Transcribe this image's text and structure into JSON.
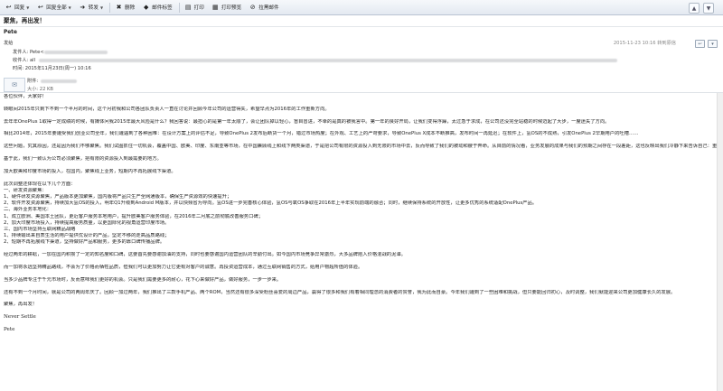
{
  "toolbar": {
    "items": [
      {
        "label": "回复",
        "icon": "reply-icon",
        "glyph": "↩",
        "dropdown": true
      },
      {
        "label": "回复全部",
        "icon": "reply-all-icon",
        "glyph": "↩",
        "dropdown": true
      },
      {
        "label": "转发",
        "icon": "forward-icon",
        "glyph": "➜",
        "dropdown": true
      },
      {
        "label": "删除",
        "icon": "delete-icon",
        "glyph": "✖",
        "dropdown": false
      },
      {
        "label": "邮件标签",
        "icon": "tag-icon",
        "glyph": "◆",
        "dropdown": false
      },
      {
        "label": "打印",
        "icon": "print-icon",
        "glyph": "▤",
        "dropdown": false
      },
      {
        "label": "打印预览",
        "icon": "print-preview-icon",
        "glyph": "▦",
        "dropdown": false
      },
      {
        "label": "拉黑邮件",
        "icon": "block-icon",
        "glyph": "⊘",
        "dropdown": false
      }
    ],
    "nav_up": "▲",
    "nav_down": "▼"
  },
  "message": {
    "subject": "聚焦，再出发！",
    "sender": "Pete",
    "from_label": "发给",
    "sender_line": "发件人: Pete<",
    "recipients_label": "收件人: all",
    "time_line": "时间: 2015年11月23日(周一) 10:16",
    "datetime": "2015-11-23 10:16",
    "datetime_suffix": "转到原信",
    "attachment_label": "附件:",
    "size_line": "大小: 22 KB"
  },
  "body": {
    "greeting": "各位伙伴，大家好！",
    "p1": "转眼间2015年只剩下不到一个半月的时间，这个月初我和公司各团队负责人一直在讨论并回顾今年公司的运营得失，希望早点为2016年的工作重新方向。",
    "p2": "去年年OnePlus 1取得一定成绩的时候，有媒体问我2015年最大风险是什么？我回答说：最担心的是第一年太顺了，会让团队掉以轻心，盲目冒进，不幸的是真的被我言中。第一年的良好开局，让我们变得浮躁，太过急于求成，在公司还没完全站稳的时候迈起了大步，一度迷失了方向。",
    "p3": "相比2014年，2015年要遭受我们创业公司全年，我们遭遇到了各种困难：在设计方案上的评估不足，导致OnePlus 2发布后断货一个月，错过市场热度；在外观、工艺上的严苛要求，导致OnePlus X成本不断推高，发布时间一再延迟；在软件上，氢OS的不成熟，引发OnePlus 2早期用户的吐槽……",
    "p4": "这些问题，究其原因，还是因为我们不够聚焦。我们试图抓住一切机会，覆盖中国、欧美、印度、东南亚等市场，在中国兼顾线上和线下两类渠道，于是把公司有限的资源投入到无限的市场中去，反而导致了我们的被动和疲于奔命。从目前的情况看，业务发展的成果与我们的预期之间存在一段差距，这也反映出我们冷静下来告诉自己：重新思考我们的业务的重点和方向。",
    "p5": "基于此，我们一致认为公司必须聚焦，把有限的资源投入到最需要的地方。",
    "p6": "加大欧美和印度市场的投入，在国内，聚焦线上业务，短期内不再拓展线下渠道。",
    "list_intro": "此次调整还体现在以下几个方面：",
    "list": [
      "一、研发资源聚焦：",
      "1、硬件研发资源聚焦，产品版本更加聚焦，国内版将产品只生产全网通版本，确保生产资源效的快速提升；",
      "2、软件开发资源聚焦，持续加大氢OS的投入，明年Q1升级到Android M版本，并以快频省为导向。氢OS进一步完善核心体验，氢OS与氧OS争取在2016年上半年实现前端的融合；同时，继续保持系统的开放性，让更多优秀的系统适配OnePlus产品。",
      "二、海外业务本地化：",
      "1、成立欧洲、美国本土团队，更近客户服务本地用户，提升欧美客户服务体验，在2016年二月底之前彻底改善服务口碑；",
      "2、加大印度市场投入，持续提高服务质量，以更国际化的视角运营印度市场。",
      "三、国内市场坚持互联网精品战略",
      "1、持续输出来自质生活的用户提供优设计的产品，坚定不移的走高品质路线；",
      "2、短期不再拓展线下渠道，坚持做好产品和服务，更多的靠口碑传播品牌。"
    ],
    "p7": "经过两年的耕耘，一加在国内积攒了一定的知名度和口碑，这要首先要感谢加油的支持，同时也要感谢国内运营团队的辛勤付出。如今国内市场竞争异常激烈，大多品牌陷入价格混战的泥潭。",
    "p8": "而一加将永远坚持精品路线，不会为了价格而牺牲品质，但我们可以更加努力让它更有对客户的诚意。再投资运营成本，通过互联网销售的方式，给用户物超所值的体验。",
    "p9": "当多少品牌专注于千元市场时，反而意味我们更好的机会。只是我们需要更多的耐心，花下心来做好产品，做好服务，一步一步来。",
    "p10": "还有不到一个月时间，就是公司的两周年庆了。回顾一加过两年，我们推出了三款手机产品、两个ROM，当然还有很多深受粉丝喜爱的周边产品，赢得了很多和我们有着相同理念的消费者的赞誉，我为此而自豪。今年我们遭到了一些困难和挑战，但只要能回归初心，及时调整，我们就能迎来公司更加健康长久的发展。",
    "closing": "聚焦，再出发！",
    "motto": "Never Settle",
    "signature": "Pete"
  }
}
